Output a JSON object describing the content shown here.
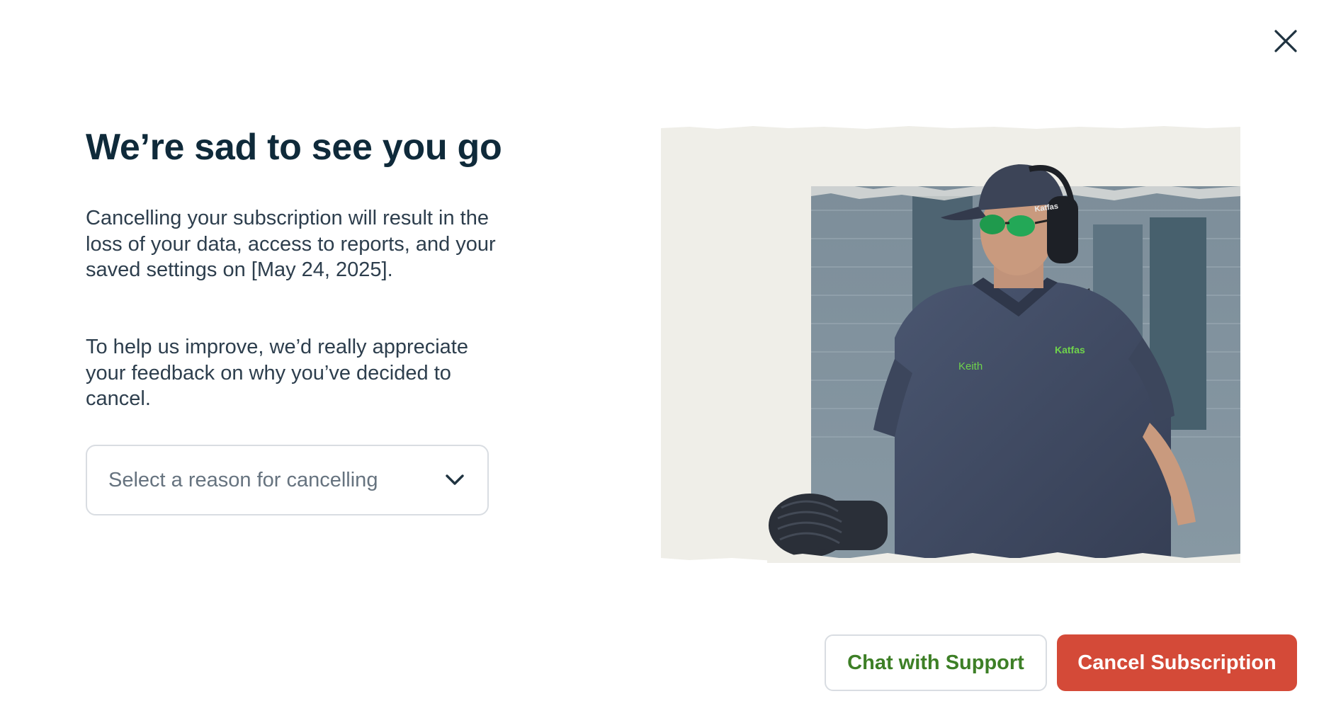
{
  "dialog": {
    "title": "We’re sad to see you go",
    "paragraph_1": "Cancelling your subscription will result in the loss of your data, access to reports, and your saved settings on [May 24, 2025].",
    "paragraph_2": "To help us improve, we’d really appreciate your feedback on why you’ve decided to cancel.",
    "close_icon": "close-icon"
  },
  "reason_select": {
    "placeholder": "Select a reason for cancelling",
    "icon": "chevron-down-icon"
  },
  "hero_image": {
    "shirt_name": "Keith",
    "brand": "Katfas"
  },
  "actions": {
    "chat_label": "Chat with Support",
    "cancel_label": "Cancel Subscription"
  },
  "colors": {
    "title": "#0f2a3a",
    "body_text": "#2d3e4d",
    "chat_text": "#3d7f26",
    "cancel_bg": "#d44a38",
    "border": "#d9dde2",
    "paper": "#efeee8"
  }
}
